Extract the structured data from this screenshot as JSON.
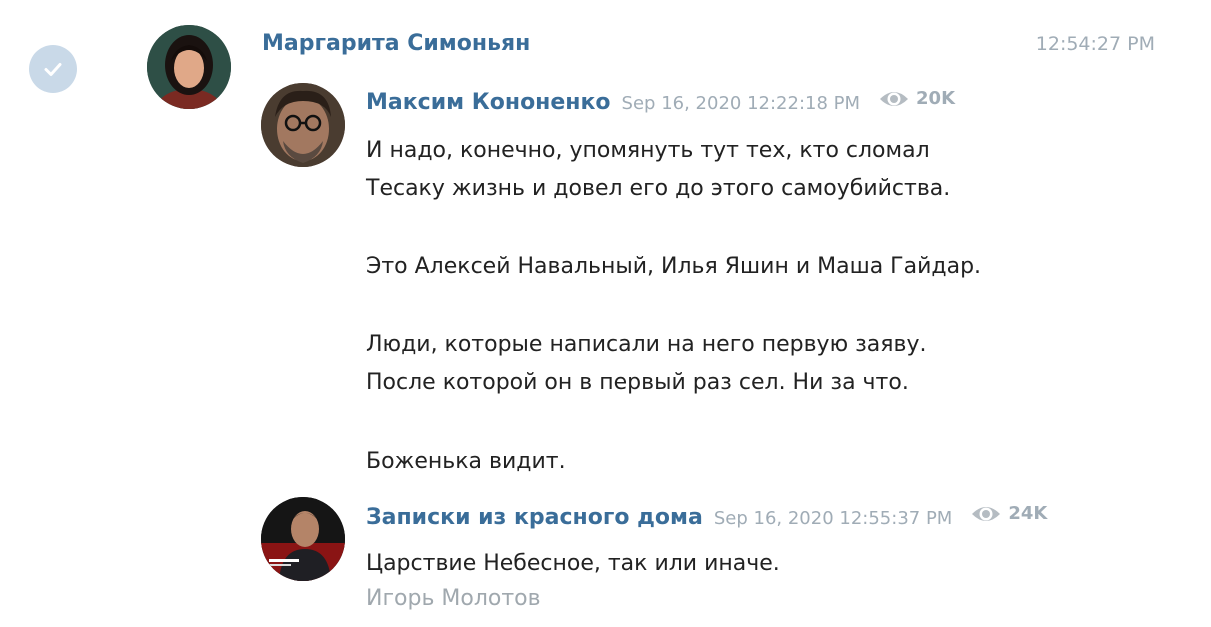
{
  "message": {
    "author": "Маргарита Симоньян",
    "time": "12:54:27 PM",
    "colors": {
      "name": "#3a6d99",
      "meta": "#a0acb6",
      "text": "#222222",
      "check_circle": "#c9d9e8"
    },
    "check_icon": "checkmark-icon"
  },
  "forward1": {
    "name": "Максим Кононенко",
    "date": "Sep 16, 2020 12:22:18 PM",
    "views": "20K",
    "views_icon": "eye-icon",
    "lines": [
      "И надо, конечно, упомянуть тут тех, кто сломал",
      "Тесаку жизнь и довел его до этого самоубийства.",
      "Это Алексей Навальный, Илья Яшин и Маша Гайдар.",
      "Люди, которые написали на него первую заяву.",
      "После которой он в первый раз сел. Ни за что.",
      "Боженька видит."
    ]
  },
  "forward2": {
    "name": "Записки из красного дома",
    "date": "Sep 16, 2020 12:55:37 PM",
    "views": "24K",
    "views_icon": "eye-icon",
    "text": "Царствие Небесное, так или иначе.",
    "signature": "Игорь Молотов"
  }
}
